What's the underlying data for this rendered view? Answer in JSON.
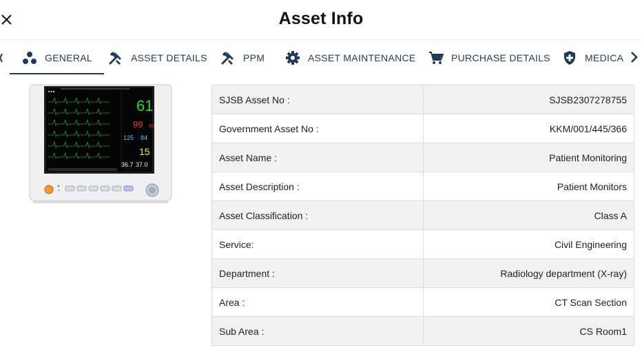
{
  "header": {
    "title": "Asset Info",
    "close_icon": "close-icon"
  },
  "tabs": [
    {
      "label": "GENERAL",
      "icon": "scatter-dots-icon",
      "active": true
    },
    {
      "label": "ASSET DETAILS",
      "icon": "tools-icon",
      "active": false
    },
    {
      "label": "PPM",
      "icon": "wrench-icon",
      "active": false
    },
    {
      "label": "ASSET MAINTENANCE",
      "icon": "gear-icon",
      "active": false
    },
    {
      "label": "PURCHASE DETAILS",
      "icon": "cart-icon",
      "active": false
    },
    {
      "label": "MEDICAL",
      "icon": "medical-shield-icon",
      "active": false
    }
  ],
  "colors": {
    "accent": "#1d3c5c",
    "row_alt": "#f2f2f2",
    "border": "#dcdcdc"
  },
  "device_screen": {
    "heart_rate": "61",
    "spo2": "99",
    "spo2_small": "60",
    "nibp": "125",
    "nibp_b": "84",
    "resp": "15",
    "temp1": "36.7",
    "temp2": "37.0"
  },
  "info_rows": [
    {
      "label": "SJSB Asset No :",
      "value": "SJSB2307278755"
    },
    {
      "label": "Government Asset No :",
      "value": "KKM/001/445/366"
    },
    {
      "label": "Asset Name :",
      "value": "Patient Monitoring"
    },
    {
      "label": "Asset Description :",
      "value": "Patient Monitors"
    },
    {
      "label": "Asset Classification :",
      "value": "Class A"
    },
    {
      "label": "Service:",
      "value": "Civil Engineering"
    },
    {
      "label": "Department :",
      "value": "Radiology department (X-ray)"
    },
    {
      "label": "Area :",
      "value": "CT Scan Section"
    },
    {
      "label": "Sub Area :",
      "value": "CS Room1"
    }
  ]
}
